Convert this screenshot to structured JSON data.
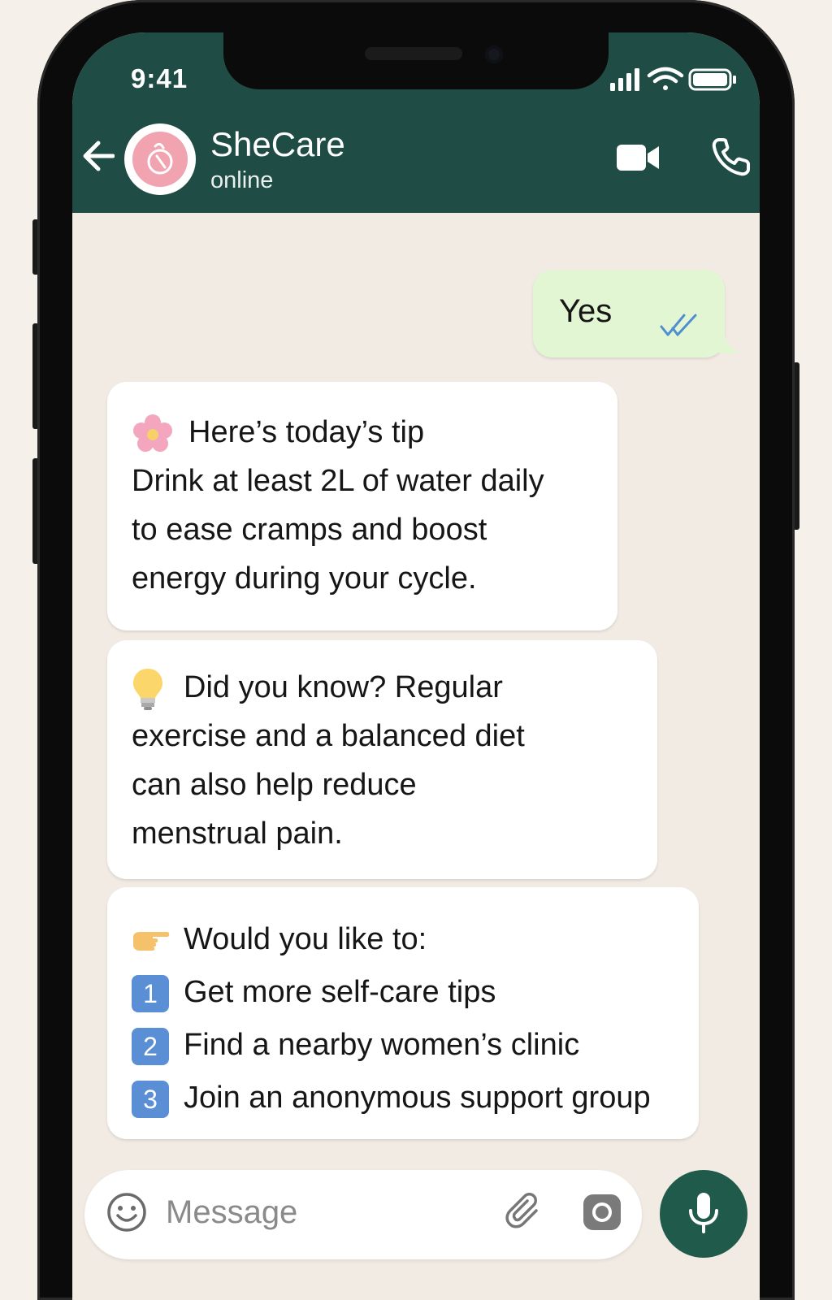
{
  "status_bar": {
    "time": "9:41"
  },
  "header": {
    "contact_name": "SheCare",
    "contact_status": "online",
    "icons": [
      "back-arrow-icon",
      "avatar-logo-icon",
      "video-call-icon",
      "voice-call-icon"
    ]
  },
  "messages": [
    {
      "direction": "outgoing",
      "text": "Yes",
      "read": true
    },
    {
      "direction": "incoming",
      "lines": [
        {
          "emoji": "flower",
          "text": "Here’s today’s tip"
        },
        {
          "text": "Drink at least 2L of water daily"
        },
        {
          "text": "to ease cramps and boost"
        },
        {
          "text": "energy during your cycle."
        }
      ]
    },
    {
      "direction": "incoming",
      "lines": [
        {
          "emoji": "light-bulb",
          "text": "Did you know? Regular"
        },
        {
          "text": "exercise and a balanced diet"
        },
        {
          "text": "can also help reduce"
        },
        {
          "text": "menstrual pain."
        }
      ]
    },
    {
      "direction": "incoming",
      "lines": [
        {
          "emoji": "pointing-hand",
          "text": "Would you like to:"
        },
        {
          "keycap": "1",
          "text": "Get more self-care tips"
        },
        {
          "keycap": "2",
          "text": "Find a nearby women’s clinic"
        },
        {
          "keycap": "3",
          "text": "Join an anonymous support group"
        }
      ]
    }
  ],
  "composer": {
    "placeholder": "Message"
  },
  "colors": {
    "header": "#1f4d45",
    "chat_background": "#f1ebe3",
    "outgoing_bubble": "#e2f6d3",
    "incoming_bubble": "#ffffff",
    "mic_button": "#1f5a4a",
    "tick_blue": "#4f8fd0",
    "avatar_pink": "#f2a3b0"
  }
}
